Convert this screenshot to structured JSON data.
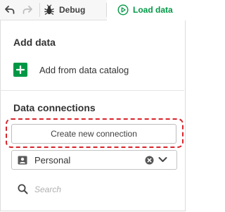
{
  "toolbar": {
    "undo_icon": "undo-arrow-icon",
    "redo_icon": "redo-arrow-icon",
    "debug_label": "Debug",
    "load_data_label": "Load data"
  },
  "add_data": {
    "title": "Add data",
    "catalog_label": "Add from data catalog"
  },
  "data_connections": {
    "title": "Data connections",
    "create_button_label": "Create new connection",
    "space_select": {
      "selected": "Personal"
    },
    "search": {
      "placeholder": "Search",
      "value": ""
    }
  },
  "colors": {
    "accent_green": "#009845",
    "highlight_red": "#d8232a"
  }
}
